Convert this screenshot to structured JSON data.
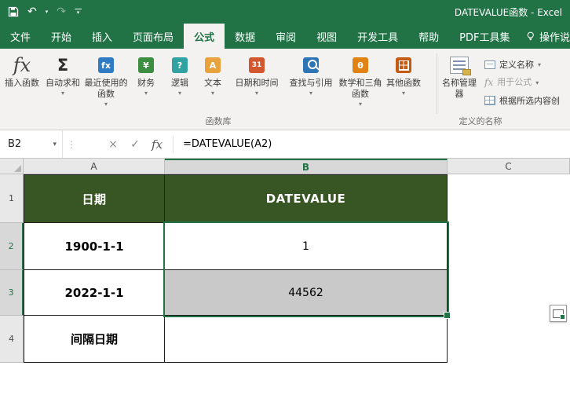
{
  "window": {
    "title": "DATEVALUE函数 - Excel"
  },
  "icons": {
    "caret": "▾",
    "fx": "fx",
    "sigma": "Σ",
    "cancel": "×",
    "enter": "✓",
    "splitter": "⋮",
    "undo": "↶",
    "redo": "↷"
  },
  "tabs": {
    "items": [
      {
        "label": "文件"
      },
      {
        "label": "开始"
      },
      {
        "label": "插入"
      },
      {
        "label": "页面布局"
      },
      {
        "label": "公式",
        "selected": true
      },
      {
        "label": "数据"
      },
      {
        "label": "审阅"
      },
      {
        "label": "视图"
      },
      {
        "label": "开发工具"
      },
      {
        "label": "帮助"
      },
      {
        "label": "PDF工具集"
      }
    ],
    "tell_me_label": "操作说"
  },
  "ribbon": {
    "function_library": {
      "group_label": "函数库",
      "insert_function": {
        "label": "插入函数"
      },
      "autosum": {
        "label": "自动求和"
      },
      "buttons": [
        {
          "label": "最近使用的函数",
          "icon": "recent-functions-icon",
          "glyph": "fx",
          "color": "#2f7cc4"
        },
        {
          "label": "财务",
          "icon": "financial-icon",
          "glyph": "¥",
          "color": "#3e8e41"
        },
        {
          "label": "逻辑",
          "icon": "logical-icon",
          "glyph": "?",
          "color": "#31a2a2"
        },
        {
          "label": "文本",
          "icon": "text-icon",
          "glyph": "A",
          "color": "#e8a33d"
        },
        {
          "label": "日期和时间",
          "icon": "calendar-icon",
          "glyph": "31",
          "color": "#d2572e"
        },
        {
          "label": "查找与引用",
          "icon": "search-icon",
          "glyph": "",
          "color": "#2e75b6"
        },
        {
          "label": "数学和三角函数",
          "icon": "theta-icon",
          "glyph": "θ",
          "color": "#e08214"
        },
        {
          "label": "其他函数",
          "icon": "grid-icon",
          "glyph": "",
          "color": "#c55a11"
        }
      ]
    },
    "defined_names": {
      "group_label": "定义的名称",
      "name_manager": {
        "label": "名称管理器"
      },
      "items": [
        {
          "label": "定义名称"
        },
        {
          "label": "用于公式",
          "disabled": true
        },
        {
          "label": "根据所选内容创"
        }
      ]
    }
  },
  "formula_bar": {
    "name_box": "B2",
    "formula": "=DATEVALUE(A2)"
  },
  "sheet": {
    "column_headers": [
      "A",
      "B",
      "C"
    ],
    "row_headers": [
      "1",
      "2",
      "3",
      "4"
    ],
    "selected_column": "B",
    "active_cell": "B2",
    "selected_range": "B2:B3",
    "cells": {
      "a1": "日期",
      "b1": "DATEVALUE",
      "a2": "1900-1-1",
      "b2": "1",
      "a3": "2022-1-1",
      "b3": "44562",
      "a4": "间隔日期",
      "b4": ""
    }
  },
  "colors": {
    "excel_green": "#217346",
    "table_header_fill": "#375623",
    "selection_fill": "#c9c9c9"
  }
}
